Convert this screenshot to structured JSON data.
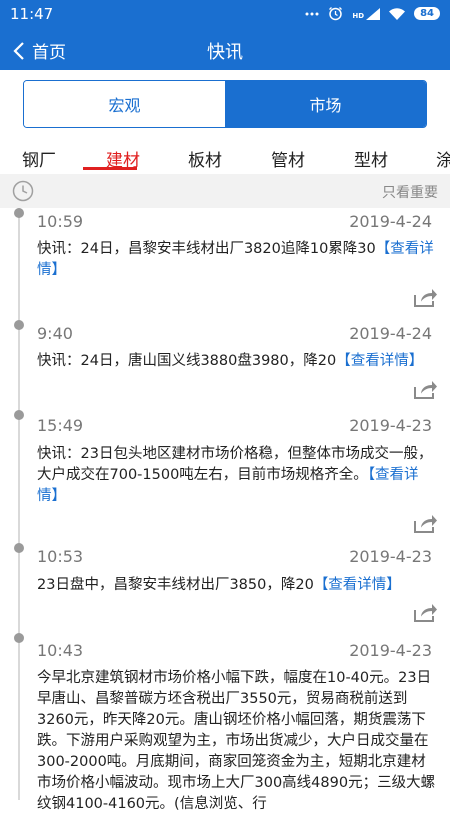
{
  "status": {
    "time": "11:47",
    "battery": "84",
    "hd_label": "HD"
  },
  "nav": {
    "back_label": "首页",
    "title": "快讯"
  },
  "segments": [
    {
      "label": "宏观",
      "active": false
    },
    {
      "label": "市场",
      "active": true
    }
  ],
  "categories": [
    {
      "label": "钢厂",
      "active": false
    },
    {
      "label": "建材",
      "active": true
    },
    {
      "label": "板材",
      "active": false
    },
    {
      "label": "管材",
      "active": false
    },
    {
      "label": "型材",
      "active": false
    },
    {
      "label": "涂",
      "active": false
    }
  ],
  "filter": {
    "important_only": "只看重要"
  },
  "detail_link": "【查看详情】",
  "news": [
    {
      "time": "10:59",
      "date": "2019-4-24",
      "text": "快讯：24日，昌黎安丰线材出厂3820追降10累降30"
    },
    {
      "time": "9:40",
      "date": "2019-4-24",
      "text": "快讯：24日，唐山国义线3880盘3980，降20"
    },
    {
      "time": "15:49",
      "date": "2019-4-23",
      "text": "快讯：23日包头地区建材市场价格稳，但整体市场成交一般，大户成交在700-1500吨左右，目前市场规格齐全。"
    },
    {
      "time": "10:53",
      "date": "2019-4-23",
      "text": "23日盘中，昌黎安丰线材出厂3850，降20"
    },
    {
      "time": "10:43",
      "date": "2019-4-23",
      "text": "今早北京建筑钢材市场价格小幅下跌，幅度在10-40元。23日早唐山、昌黎普碳方坯含税出厂3550元，贸易商税前送到3260元，昨天降20元。唐山钢坯价格小幅回落，期货震荡下跌。下游用户采购观望为主，市场出货减少，大户日成交量在300-2000吨。月底期间，商家回笼资金为主，短期北京建材市场价格小幅波动。现市场上大厂300高线4890元；三级大螺纹钢4100-4160元。(信息浏览、行"
    }
  ]
}
